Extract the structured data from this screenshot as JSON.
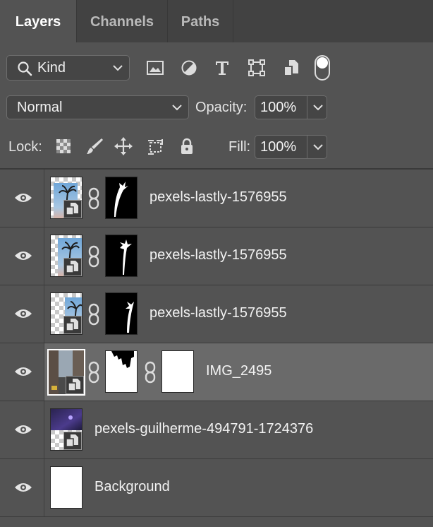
{
  "tabs": [
    {
      "label": "Layers",
      "active": true
    },
    {
      "label": "Channels",
      "active": false
    },
    {
      "label": "Paths",
      "active": false
    }
  ],
  "filter": {
    "kind_label": "Kind",
    "icons": [
      "image-filter-icon",
      "adjustment-filter-icon",
      "type-filter-icon",
      "shape-filter-icon",
      "smart-object-filter-icon",
      "filter-toggle-switch"
    ]
  },
  "blend": {
    "mode": "Normal",
    "opacity_label": "Opacity:",
    "opacity_value": "100%"
  },
  "lock": {
    "label": "Lock:",
    "icons": [
      "lock-transparent-pixels-icon",
      "lock-image-pixels-icon",
      "lock-position-icon",
      "lock-artboard-icon",
      "lock-all-icon"
    ],
    "fill_label": "Fill:",
    "fill_value": "100%"
  },
  "layers": [
    {
      "name": "pexels-lastly-1576955",
      "visible": true,
      "selected": false,
      "has_mask": true,
      "thumb": "palm"
    },
    {
      "name": "pexels-lastly-1576955",
      "visible": true,
      "selected": false,
      "has_mask": true,
      "thumb": "palm"
    },
    {
      "name": "pexels-lastly-1576955",
      "visible": true,
      "selected": false,
      "has_mask": true,
      "thumb": "palm-partial"
    },
    {
      "name": "IMG_2495",
      "visible": true,
      "selected": true,
      "has_mask": true,
      "has_vector_mask": true,
      "thumb": "street"
    },
    {
      "name": "pexels-guilherme-494791-1724376",
      "visible": true,
      "selected": false,
      "has_mask": false,
      "thumb": "purple"
    },
    {
      "name": "Background",
      "visible": true,
      "selected": false,
      "has_mask": false,
      "thumb": "white"
    }
  ],
  "colors": {
    "panel": "#535353",
    "tabbar": "#424242",
    "selected_row": "#6a6a6a",
    "mask_black": "#000000",
    "mask_white": "#ffffff"
  }
}
